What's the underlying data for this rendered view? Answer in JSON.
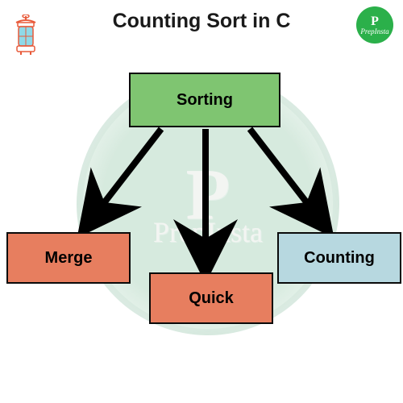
{
  "title": "Counting Sort in C",
  "badge": {
    "label": "PrepInsta"
  },
  "watermark": {
    "text": "PrepInsta"
  },
  "nodes": {
    "root": {
      "label": "Sorting",
      "color": "#7fc571"
    },
    "left": {
      "label": "Merge",
      "color": "#e77e5f"
    },
    "center": {
      "label": "Quick",
      "color": "#e77e5f"
    },
    "right": {
      "label": "Counting",
      "color": "#b7d8e0"
    }
  },
  "chart_data": {
    "type": "diagram",
    "title": "Counting Sort in C",
    "nodes": [
      {
        "id": "sorting",
        "label": "Sorting"
      },
      {
        "id": "merge",
        "label": "Merge"
      },
      {
        "id": "quick",
        "label": "Quick"
      },
      {
        "id": "counting",
        "label": "Counting"
      }
    ],
    "edges": [
      {
        "from": "sorting",
        "to": "merge"
      },
      {
        "from": "sorting",
        "to": "quick"
      },
      {
        "from": "sorting",
        "to": "counting"
      }
    ]
  }
}
